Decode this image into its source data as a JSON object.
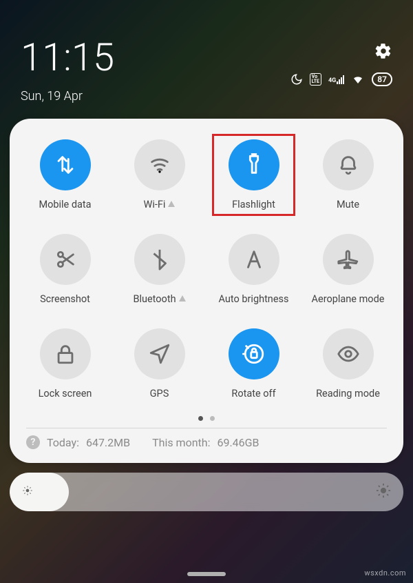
{
  "statusbar": {
    "time": "11:15",
    "date": "Sun, 19 Apr",
    "battery": "87",
    "network_label": "4G",
    "volte_label": "Vo LTE"
  },
  "tiles": [
    {
      "label": "Mobile data",
      "icon": "data-arrows",
      "active": true,
      "chevron": false,
      "highlight": false
    },
    {
      "label": "Wi-Fi",
      "icon": "wifi",
      "active": false,
      "chevron": true,
      "highlight": false
    },
    {
      "label": "Flashlight",
      "icon": "flashlight",
      "active": true,
      "chevron": false,
      "highlight": true
    },
    {
      "label": "Mute",
      "icon": "bell",
      "active": false,
      "chevron": false,
      "highlight": false
    },
    {
      "label": "Screenshot",
      "icon": "scissors",
      "active": false,
      "chevron": false,
      "highlight": false
    },
    {
      "label": "Bluetooth",
      "icon": "bluetooth",
      "active": false,
      "chevron": true,
      "highlight": false
    },
    {
      "label": "Auto brightness",
      "icon": "letter-a",
      "active": false,
      "chevron": false,
      "highlight": false
    },
    {
      "label": "Aeroplane mode",
      "icon": "airplane",
      "active": false,
      "chevron": false,
      "highlight": false
    },
    {
      "label": "Lock screen",
      "icon": "lock",
      "active": false,
      "chevron": false,
      "highlight": false
    },
    {
      "label": "GPS",
      "icon": "navigate",
      "active": false,
      "chevron": false,
      "highlight": false
    },
    {
      "label": "Rotate off",
      "icon": "rotate-lock",
      "active": true,
      "chevron": false,
      "highlight": false
    },
    {
      "label": "Reading mode",
      "icon": "eye",
      "active": false,
      "chevron": false,
      "highlight": false
    }
  ],
  "usage": {
    "today_label": "Today:",
    "today_value": "647.2MB",
    "month_label": "This month:",
    "month_value": "69.46GB"
  },
  "brightness": {
    "percent": 15
  },
  "watermark": "wsxdn.com"
}
